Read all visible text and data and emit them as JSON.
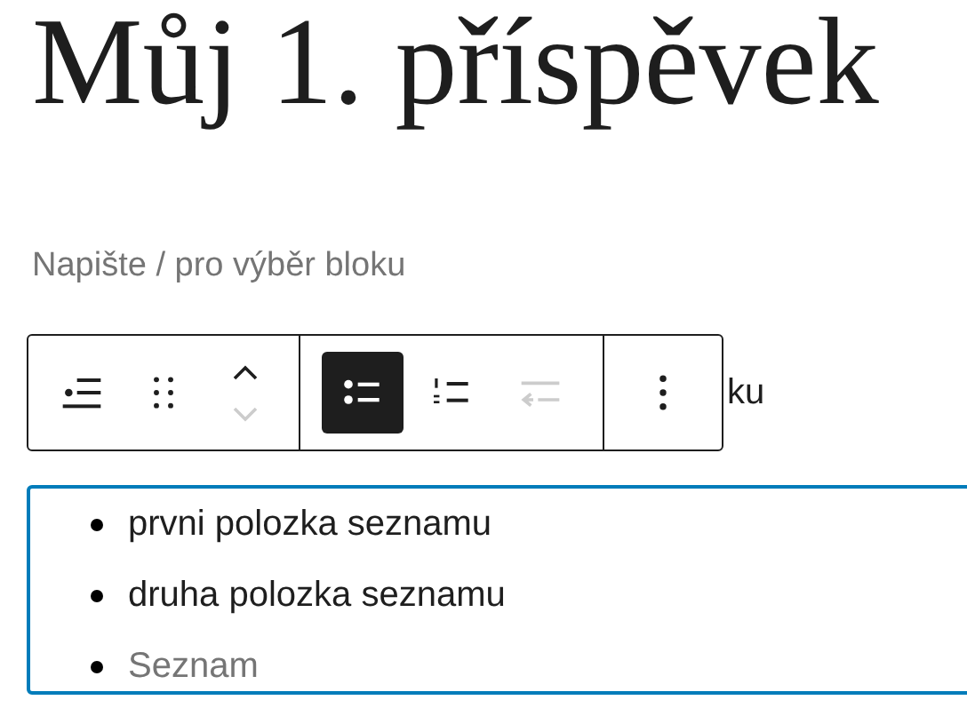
{
  "title": "Můj 1. příspěvek",
  "block_hint": "Napište / pro výběr bloku",
  "paragraph_tail": "ku",
  "toolbar": {
    "groups": [
      [
        {
          "kind": "parent",
          "disabled": false
        },
        {
          "kind": "drag",
          "disabled": false
        },
        {
          "kind": "mover",
          "up_disabled": false,
          "down_disabled": true
        }
      ],
      [
        {
          "kind": "unordered",
          "disabled": false,
          "selected": true
        },
        {
          "kind": "ordered",
          "disabled": false,
          "selected": false
        },
        {
          "kind": "outdent",
          "disabled": true
        }
      ],
      [
        {
          "kind": "more",
          "disabled": false
        }
      ]
    ]
  },
  "list": {
    "items": [
      {
        "text": "prvni polozka seznamu"
      },
      {
        "text": "druha polozka seznamu"
      },
      {
        "placeholder": "Seznam"
      }
    ]
  }
}
